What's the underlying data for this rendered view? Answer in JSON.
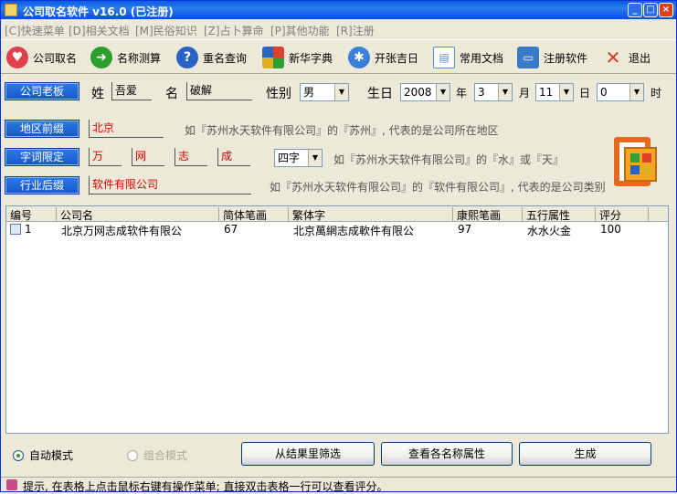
{
  "window": {
    "title": "公司取名软件 v16.0 (已注册)"
  },
  "menu": [
    "[C]快速菜单",
    "[D]相关文档",
    "[M]民俗知识",
    "[Z]占卜算命",
    "[P]其他功能",
    "[R]注册"
  ],
  "toolbar": [
    {
      "label": "公司取名",
      "icon": "heart-icon",
      "color": "#e0404a"
    },
    {
      "label": "名称测算",
      "icon": "arrow-right-icon",
      "color": "#2e9e2e"
    },
    {
      "label": "重名查询",
      "icon": "question-icon",
      "color": "#2a63c4"
    },
    {
      "label": "新华字典",
      "icon": "windows-logo-icon",
      "color": "#e08a1e"
    },
    {
      "label": "开张吉日",
      "icon": "calendar-icon",
      "color": "#3a7fd8"
    },
    {
      "label": "常用文档",
      "icon": "document-icon",
      "color": "#5a8fd0"
    },
    {
      "label": "注册软件",
      "icon": "computer-icon",
      "color": "#3a78c8"
    },
    {
      "label": "退出",
      "icon": "close-x-icon",
      "color": "#d23a2a"
    }
  ],
  "boss": {
    "button": "公司老板",
    "surname_label": "姓",
    "surname": "吾爱",
    "name_label": "名",
    "name": "破解",
    "gender_label": "性别",
    "gender": "男",
    "birth_label": "生日",
    "year": "2008",
    "year_label": "年",
    "month": "3",
    "month_label": "月",
    "day": "11",
    "day_label": "日",
    "hour": "0",
    "hour_label": "时"
  },
  "region": {
    "button": "地区前缀",
    "value": "北京",
    "hint": "如『苏州水天软件有限公司』的『苏州』, 代表的是公司所在地区"
  },
  "words": {
    "button": "字词限定",
    "chars": [
      "万",
      "网",
      "志",
      "成"
    ],
    "length": "四字",
    "hint": "如『苏州水天软件有限公司』的『水』或『天』"
  },
  "industry": {
    "button": "行业后缀",
    "value": "软件有限公司",
    "hint": "如『苏州水天软件有限公司』的『软件有限公司』, 代表的是公司类别"
  },
  "table": {
    "columns": [
      "编号",
      "公司名",
      "简体笔画",
      "繁体字",
      "康熙笔画",
      "五行属性",
      "评分"
    ],
    "rows": [
      [
        "1",
        "北京万网志成软件有限公",
        "67",
        "北京萬網志成軟件有限公",
        "97",
        "水水火金",
        "100"
      ]
    ]
  },
  "mode": {
    "auto": "自动模式",
    "combo": "组合模式"
  },
  "actions": {
    "filter": "从结果里筛选",
    "attributes": "查看各名称属性",
    "generate": "生成"
  },
  "status": "提示, 在表格上点击鼠标右键有操作菜单; 直接双击表格一行可以查看评分。"
}
